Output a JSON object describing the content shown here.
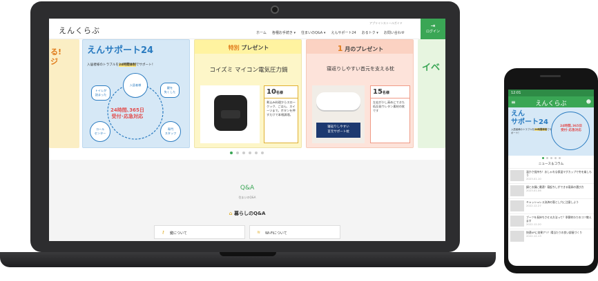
{
  "site": {
    "logo": "えんくらぶ",
    "util_link": "アプリインストールガイド",
    "nav": [
      "ホーム",
      "各種お手続き ▾",
      "住まいのQ&A ▾",
      "えんサポート24",
      "おるトク ▾",
      "お問い合わせ"
    ],
    "login": "ログイン"
  },
  "slides": {
    "left_partial": "る!\nジ",
    "support": {
      "title": "えんサポート24",
      "sub_pre": "入居者様のトラブルを",
      "sub_hl": "24時間体制",
      "sub_post": "でサポート！",
      "hub_resident": "入居者様",
      "hub_toilet": "トイレが\n詰まった",
      "hub_key": "鍵を\n失くした",
      "hub_call": "コール\nセンター",
      "hub_staff": "専門\nスタッフ",
      "center_text": "24時間､365日\n受付･応急対応"
    },
    "special": {
      "head_hl": "特別",
      "head_rest": "プレゼント",
      "item": "コイズミ マイコン電気圧力鍋",
      "count": "10",
      "count_unit": "名様",
      "desc": "煮込み料理からスロークック、ごはん、スイーツまで。ボタンを押すだけで本格調理。"
    },
    "monthly": {
      "head_hl": "1",
      "head_rest": "月のプレゼント",
      "item": "寝返りしやすい首元を支える枕",
      "label": "寝返りしやすい\n首元サポート枕",
      "count": "15",
      "count_unit": "名様",
      "desc": "左右が少し高めにできた低反発ウレタン素材の枕です"
    },
    "right_partial": "イベ"
  },
  "qa": {
    "title": "Q&A",
    "sub": "住まいのQ&A",
    "head": "暮らしのQ&A",
    "btn_key": "鍵について",
    "btn_wifi": "Wi-Fiについて"
  },
  "phone": {
    "time": "12:01",
    "logo": "えんくらぶ",
    "banner_title": "えん\nサポート24",
    "banner_sub_pre": "入居者様のトラブルを",
    "banner_sub_hl": "24時間体制",
    "banner_sub_post": "でサポート！",
    "banner_ring": "24時間､365日\n受付･応急対応",
    "news_head": "ニュース＆コラム",
    "news": [
      {
        "title": "温かさ長持ち！おしゃれな保温マグカップで冬を楽しもう",
        "date": "2023.01.10"
      },
      {
        "title": "鍋とお鍋に最適！寝起ちしができる寝具の選び方",
        "date": "2023.01.06"
      },
      {
        "title": "キャッシュレス決済の落とし穴に注意しよう",
        "date": "2022.12.27"
      },
      {
        "title": "ブーツを長持ちさせる方法って？季節終わりのコツ教えます",
        "date": "2022.12.20"
      },
      {
        "title": "快適UPに効果アリ！陽当たりの良い部屋づくり",
        "date": "2022.12.13"
      }
    ]
  },
  "colors": {
    "brand_green": "#3aa655",
    "support_blue": "#2a7bc0",
    "accent_red": "#e24d4d"
  }
}
